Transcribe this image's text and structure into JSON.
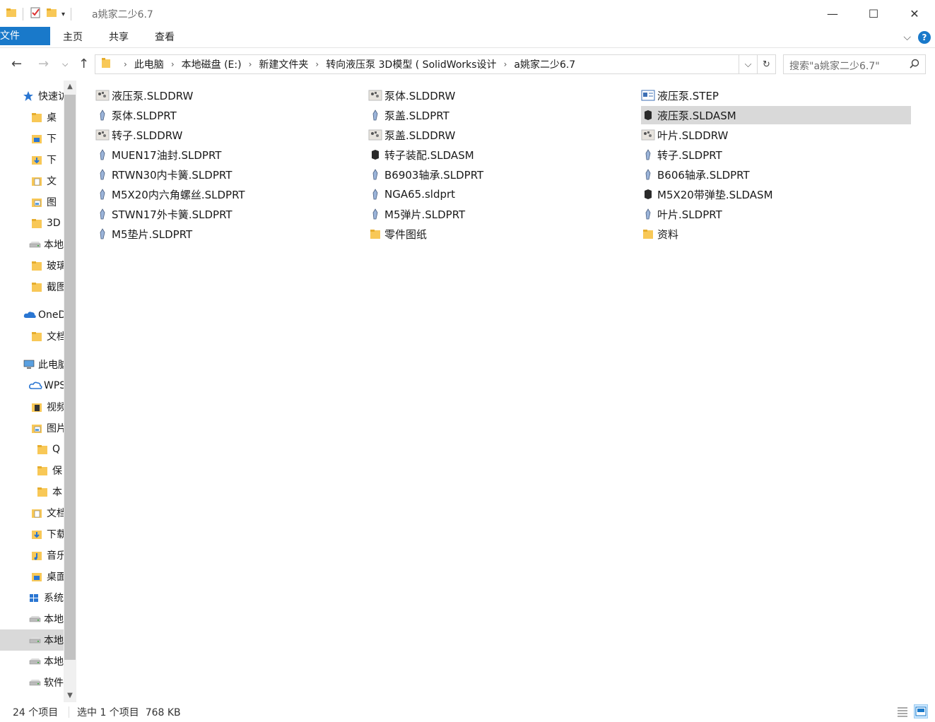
{
  "window": {
    "title": "a姚家二少6.7",
    "minimize": "—",
    "maximize": "☐",
    "close": "✕"
  },
  "ribbon": {
    "tabs": [
      "文件",
      "主页",
      "共享",
      "查看"
    ]
  },
  "nav": {
    "breadcrumbs": [
      "此电脑",
      "本地磁盘 (E:)",
      "新建文件夹",
      "转向液压泵 3D模型 ( SolidWorks设计",
      "a姚家二少6.7"
    ],
    "search_placeholder": "搜索\"a姚家二少6.7\""
  },
  "sidebar": {
    "items": [
      {
        "label": "快速访",
        "icon": "star-icon"
      },
      {
        "label": "桌",
        "icon": "folder-icon"
      },
      {
        "label": "下",
        "icon": "desktop-icon"
      },
      {
        "label": "下",
        "icon": "download-icon"
      },
      {
        "label": "文",
        "icon": "document-icon"
      },
      {
        "label": "图",
        "icon": "picture-icon"
      },
      {
        "label": "3D",
        "icon": "folder-icon"
      },
      {
        "label": "本地",
        "icon": "drive-icon"
      },
      {
        "label": "玻璃",
        "icon": "folder-icon"
      },
      {
        "label": "截图",
        "icon": "folder-icon"
      },
      {
        "label": "OneD",
        "icon": "cloud-icon"
      },
      {
        "label": "文档",
        "icon": "folder-icon"
      },
      {
        "label": "此电脑",
        "icon": "computer-icon"
      },
      {
        "label": "WPS",
        "icon": "wps-cloud-icon"
      },
      {
        "label": "视频",
        "icon": "video-icon"
      },
      {
        "label": "图片",
        "icon": "picture-icon"
      },
      {
        "label": "Q",
        "icon": "folder-icon"
      },
      {
        "label": "保",
        "icon": "folder-icon"
      },
      {
        "label": "本",
        "icon": "folder-icon"
      },
      {
        "label": "文档",
        "icon": "document-icon"
      },
      {
        "label": "下载",
        "icon": "download-icon"
      },
      {
        "label": "音乐",
        "icon": "music-icon"
      },
      {
        "label": "桌面",
        "icon": "desktop-icon"
      },
      {
        "label": "系统",
        "icon": "windows-icon"
      },
      {
        "label": "本地",
        "icon": "drive-icon"
      },
      {
        "label": "本地",
        "icon": "drive-icon"
      },
      {
        "label": "本地",
        "icon": "drive-icon"
      },
      {
        "label": "软件",
        "icon": "drive-icon"
      }
    ]
  },
  "files": [
    {
      "name": "液压泵.SLDDRW",
      "icon": "drawing-icon"
    },
    {
      "name": "泵体.SLDPRT",
      "icon": "part-icon"
    },
    {
      "name": "转子.SLDDRW",
      "icon": "drawing-icon"
    },
    {
      "name": "MUEN17油封.SLDPRT",
      "icon": "part-icon"
    },
    {
      "name": "RTWN30内卡簧.SLDPRT",
      "icon": "part-icon"
    },
    {
      "name": "M5X20内六角螺丝.SLDPRT",
      "icon": "part-icon"
    },
    {
      "name": "STWN17外卡簧.SLDPRT",
      "icon": "part-icon"
    },
    {
      "name": "M5垫片.SLDPRT",
      "icon": "part-icon"
    },
    {
      "name": "泵体.SLDDRW",
      "icon": "drawing-icon"
    },
    {
      "name": "泵盖.SLDPRT",
      "icon": "part-icon"
    },
    {
      "name": "泵盖.SLDDRW",
      "icon": "drawing-icon"
    },
    {
      "name": "转子装配.SLDASM",
      "icon": "assembly-icon"
    },
    {
      "name": "B6903轴承.SLDPRT",
      "icon": "part-icon"
    },
    {
      "name": "NGA65.sldprt",
      "icon": "part-icon"
    },
    {
      "name": "M5弹片.SLDPRT",
      "icon": "part-icon"
    },
    {
      "name": "零件图纸",
      "icon": "folder-icon"
    },
    {
      "name": "液压泵.STEP",
      "icon": "step-file-icon"
    },
    {
      "name": "液压泵.SLDASM",
      "icon": "assembly-icon",
      "selected": true
    },
    {
      "name": "叶片.SLDDRW",
      "icon": "drawing-icon"
    },
    {
      "name": "转子.SLDPRT",
      "icon": "part-icon"
    },
    {
      "name": "B606轴承.SLDPRT",
      "icon": "part-icon"
    },
    {
      "name": "M5X20带弹垫.SLDASM",
      "icon": "assembly-icon"
    },
    {
      "name": "叶片.SLDPRT",
      "icon": "part-icon"
    },
    {
      "name": "资料",
      "icon": "folder-icon"
    }
  ],
  "status": {
    "count": "24 个项目",
    "selection": "选中 1 个项目  768 KB"
  },
  "colors": {
    "accent": "#1979ca",
    "selected_bg": "#d9d9d9",
    "folder": "#f8c857"
  }
}
